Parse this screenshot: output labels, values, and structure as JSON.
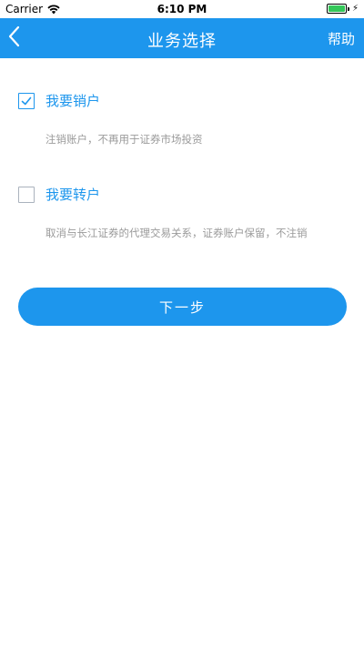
{
  "status_bar": {
    "carrier": "Carrier",
    "time": "6:10 PM"
  },
  "nav": {
    "title": "业务选择",
    "help_label": "帮助",
    "back_icon": "chevron-left-icon"
  },
  "options": [
    {
      "label": "我要销户",
      "description": "注销账户，不再用于证券市场投资",
      "checked": true
    },
    {
      "label": "我要转户",
      "description": "取消与长江证券的代理交易关系，证券账户保留，不注销",
      "checked": false
    }
  ],
  "next_button": {
    "label": "下一步"
  },
  "colors": {
    "primary": "#1d96ed",
    "description_text": "#9a9a9a",
    "battery": "#34c759"
  }
}
